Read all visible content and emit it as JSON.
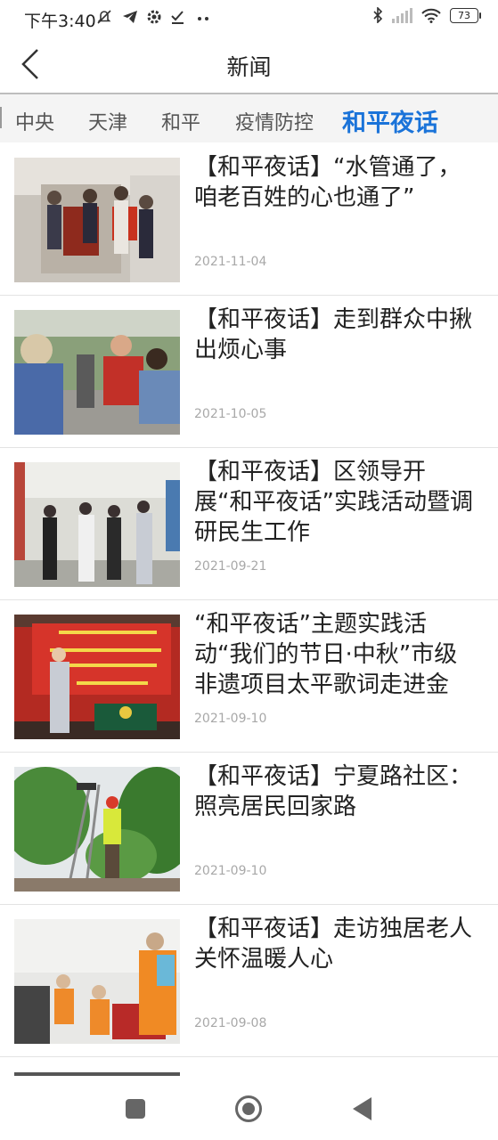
{
  "status_bar": {
    "time": "下午3:40",
    "battery": "73"
  },
  "header": {
    "title": "新闻"
  },
  "tabs": [
    {
      "label": "中央",
      "active": false
    },
    {
      "label": "天津",
      "active": false
    },
    {
      "label": "和平",
      "active": false
    },
    {
      "label": "疫情防控",
      "active": false
    },
    {
      "label": "和平夜话",
      "active": true
    }
  ],
  "news": [
    {
      "title": "【和平夜话】“水管通了，咱老百姓的心也通了”",
      "date": "2021-11-04"
    },
    {
      "title": "【和平夜话】走到群众中揪出烦心事",
      "date": "2021-10-05"
    },
    {
      "title": "【和平夜话】区领导开展“和平夜话”实践活动暨调研民生工作",
      "date": "2021-09-21"
    },
    {
      "title": "“和平夜话”主题实践活动“我们的节日·中秋”市级非遗项目太平歌词走进金泉…",
      "date": "2021-09-10"
    },
    {
      "title": "【和平夜话】宁夏路社区：照亮居民回家路",
      "date": "2021-09-10"
    },
    {
      "title": "【和平夜话】走访独居老人 关怀温暖人心",
      "date": "2021-09-08"
    }
  ],
  "colors": {
    "accent": "#1a73d9",
    "date_text": "#a8a8a8"
  }
}
